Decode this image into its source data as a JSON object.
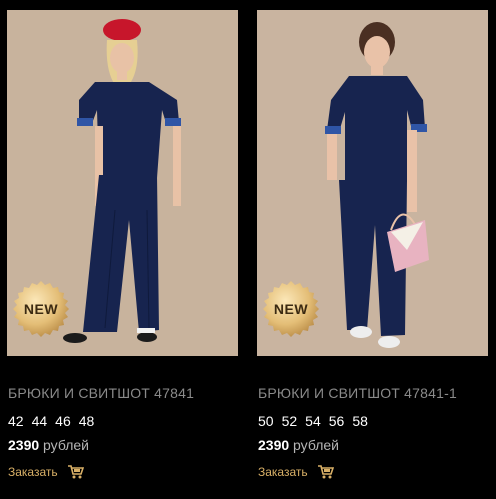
{
  "products": [
    {
      "badge": "NEW",
      "title": "БРЮКИ И СВИТШОТ 47841",
      "sizes": [
        "42",
        "44",
        "46",
        "48"
      ],
      "price_amount": "2390",
      "price_currency": "рублей",
      "order_label": "Заказать"
    },
    {
      "badge": "NEW",
      "title": "БРЮКИ И СВИТШОТ 47841-1",
      "sizes": [
        "50",
        "52",
        "54",
        "56",
        "58"
      ],
      "price_amount": "2390",
      "price_currency": "рублей",
      "order_label": "Заказать"
    }
  ],
  "colors": {
    "background": "#000000",
    "photo_background": "#c6b09a",
    "outfit_navy": "#17244f",
    "accent_gold": "#d9b067",
    "title_gray": "#8a8a8a"
  },
  "icons": {
    "cart": "shopping-cart-icon",
    "badge": "new-badge-icon"
  }
}
